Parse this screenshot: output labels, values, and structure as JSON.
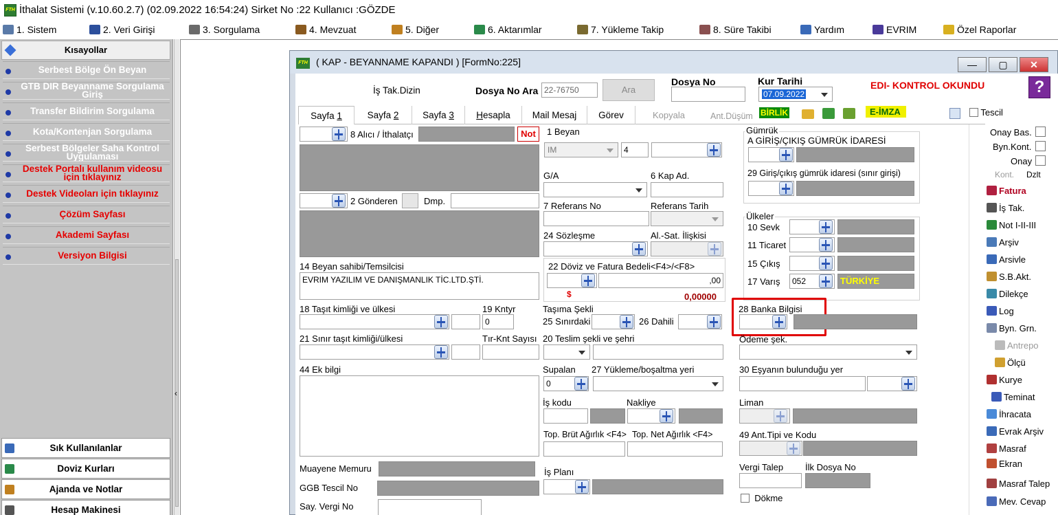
{
  "window": {
    "title": "İthalat Sistemi (v.10.60.2.7) (02.09.2022 16:54:24) Sirket No :22 Kullanıcı :GÖZDE"
  },
  "menu": [
    {
      "label": "1.  Sistem",
      "icon": "computer-icon"
    },
    {
      "label": "2.  Veri Girişi",
      "icon": "edit-icon"
    },
    {
      "label": "3.  Sorgulama",
      "icon": "query-icon"
    },
    {
      "label": "4.  Mevzuat",
      "icon": "books-icon"
    },
    {
      "label": "5.  Diğer",
      "icon": "tools-icon"
    },
    {
      "label": "6.  Aktarımlar",
      "icon": "transfer-icon"
    },
    {
      "label": "7.  Yükleme Takip",
      "icon": "truck-icon"
    },
    {
      "label": "8. Süre Takibi",
      "icon": "clipboard-icon"
    },
    {
      "label": "Yardım",
      "icon": "help-icon"
    },
    {
      "label": "EVRIM",
      "icon": "evrim-icon"
    },
    {
      "label": "Özel Raporlar",
      "icon": "star-icon"
    }
  ],
  "sidebar": {
    "header": "Kısayollar",
    "items": [
      {
        "label": "Serbest Bölge Ön Beyan",
        "red": false
      },
      {
        "label": "GTB DIR Beyanname Sorgulama Giriş",
        "red": false
      },
      {
        "label": "Transfer Bildirim Sorgulama",
        "red": false
      },
      {
        "label": "Kota/Kontenjan Sorgulama",
        "red": false
      },
      {
        "label": "Serbest Bölgeler Saha Kontrol Uygulaması",
        "red": false
      },
      {
        "label": "Destek Portalı kullanım videosu için tıklayınız",
        "red": true
      },
      {
        "label": "Destek Videoları için tıklayınız",
        "red": true
      },
      {
        "label": "Çözüm Sayfası",
        "red": true
      },
      {
        "label": "Akademi Sayfası",
        "red": true
      },
      {
        "label": "Versiyon Bilgisi",
        "red": true
      }
    ],
    "bottom": [
      "Sık Kullanılanlar",
      "Doviz Kurları",
      "Ajanda ve Notlar",
      "Hesap Makinesi"
    ]
  },
  "form": {
    "title": "( KAP - BEYANNAME  KAPANDI ) [FormNo:225]",
    "is_tak_dizin": "İş Tak.Dizin",
    "dosya_no_ara_label": "Dosya No Ara",
    "dosya_no_ara_value": "22-76750",
    "ara_button": "Ara",
    "dosya_no_label": "Dosya No",
    "kur_tarihi_label": "Kur Tarihi",
    "kur_tarihi_value": "07.09.2022",
    "edi_status": "EDI- KONTROL OKUNDU",
    "tabs": [
      {
        "pre": "Sayfa ",
        "key": "1"
      },
      {
        "pre": "Sayfa ",
        "key": "2"
      },
      {
        "pre": "Sayfa ",
        "key": "3"
      },
      {
        "pre": "",
        "key": "H",
        "post": "esapla"
      },
      {
        "pre": "Mail Mesaj",
        "key": ""
      },
      {
        "pre": "Görev",
        "key": ""
      }
    ],
    "kopyala": "Kopyala",
    "ant_dusum": "Ant.Düşüm",
    "birlik": "BİRLİK",
    "eimza": "E-İMZA",
    "tescil": "Tescil",
    "f8": "8 Alıcı / İthalatçı",
    "not_label": "Not",
    "f2": "2 Gönderen",
    "dmp": "Dmp.",
    "f14": "14 Beyan sahibi/Temsilcisi",
    "f14_value": "EVRIM YAZILIM VE DANIŞMANLIK TİC.LTD.ŞTİ.",
    "f18": "18 Taşıt kimliği ve ülkesi",
    "f19": "19 Kntyr",
    "f19_value": "0",
    "f21": "21 Sınır taşıt kimliği/ülkesi",
    "tir_knt": "Tır-Knt Sayısı",
    "f44": "44 Ek bilgi",
    "muayene": "Muayene Memuru",
    "ggb": "GGB Tescil No",
    "say_vergi": "Say. Vergi No",
    "f1": "1 Beyan",
    "f1_combo": "IM",
    "f1_num": "4",
    "ga": "G/A",
    "f6": "6 Kap Ad.",
    "f7": "7 Referans No",
    "ref_tarih": "Referans Tarih",
    "f24": "24 Sözleşme",
    "al_sat": "Al.-Sat. İlişkisi",
    "f22": "22 Döviz ve Fatura Bedeli<F4>/<F8>",
    "f22_value": ",00",
    "dollar": "$",
    "f22_rate": "0,00000",
    "tasima": "Taşıma Şekli",
    "f25": "25 Sınırdaki",
    "f26": "26 Dahili",
    "f20": "20 Teslim şekli ve şehri",
    "supalan": "Supalan",
    "supalan_value": "0",
    "f27": "27 Yükleme/boşaltma yeri",
    "is_kodu": "İş kodu",
    "nakliye": "Nakliye",
    "brut": "Top. Brüt Ağırlık <F4>",
    "net": "Top. Net Ağırlık <F4>",
    "is_plani": "İş Planı",
    "gumruk": "Gümrük",
    "gumruk_sub": "A GİRİŞ/ÇIKIŞ GÜMRÜK İDARESİ",
    "f29": "29 Giriş/çıkış gümrük idaresi (sınır girişi)",
    "ulkeler": "Ülkeler",
    "f10": "10 Sevk",
    "f11": "11 Ticaret",
    "f15": "15 Çıkış",
    "f17": "17 Varış",
    "f17_code": "052",
    "f17_name": "TÜRKİYE",
    "f28": "28 Banka Bilgisi",
    "odeme": "Ödeme şek.",
    "f30": "30 Eşyanın bulunduğu yer",
    "liman": "Liman",
    "f49": "49 Ant.Tipi ve Kodu",
    "vergi_talep": "Vergi Talep",
    "ilk_dosya": "İlk Dosya No",
    "dokme": "Dökme"
  },
  "right_panel": {
    "onay_bas": "Onay Bas.",
    "byn_kont": "Byn.Kont.",
    "onay": "Onay",
    "kont": "Kont.",
    "dzlt": "Dzlt",
    "items": [
      {
        "label": "Fatura",
        "icon": "invoice-icon",
        "color": "#b00020"
      },
      {
        "label": "İş Tak.",
        "icon": "track-icon",
        "color": "#000000"
      },
      {
        "label": "Not I-II-III",
        "icon": "note-icon",
        "color": "#000000"
      },
      {
        "label": "Arşiv",
        "icon": "archive-icon",
        "color": "#000000"
      },
      {
        "label": "Arsivle",
        "icon": "archive-add-icon",
        "color": "#000000"
      },
      {
        "label": "S.B.Akt.",
        "icon": "sb-transfer-icon",
        "color": "#000000"
      },
      {
        "label": "Dilekçe",
        "icon": "petition-icon",
        "color": "#000000"
      },
      {
        "label": "Log",
        "icon": "log-icon",
        "color": "#000000"
      },
      {
        "label": "Byn. Grn.",
        "icon": "view-icon",
        "color": "#000000"
      },
      {
        "label": "Antrepo",
        "icon": "warehouse-icon",
        "color": "#9a9a9a"
      },
      {
        "label": "Ölçü",
        "icon": "measure-icon",
        "color": "#000000"
      },
      {
        "label": "Kurye",
        "icon": "courier-icon",
        "color": "#000000"
      },
      {
        "label": "Teminat",
        "icon": "guarantee-icon",
        "color": "#000000"
      },
      {
        "label": "İhracata",
        "icon": "export-icon",
        "color": "#000000"
      },
      {
        "label": "Evrak Arşiv",
        "icon": "document-archive-icon",
        "color": "#000000"
      },
      {
        "label": "Masraf",
        "icon": "expense-icon",
        "color": "#000000"
      },
      {
        "label": "Ekran",
        "icon": "screen-icon",
        "color": "#000000"
      },
      {
        "label": "Masraf Talep",
        "icon": "expense-request-icon",
        "color": "#000000"
      },
      {
        "label": "Mev. Cevap",
        "icon": "reply-icon",
        "color": "#000000"
      }
    ]
  },
  "highlight_color": "#e00000"
}
